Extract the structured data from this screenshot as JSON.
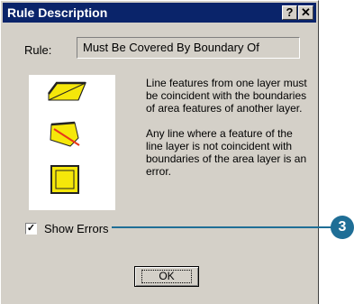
{
  "window": {
    "title": "Rule Description",
    "help_label": "?",
    "close_label": "✕"
  },
  "rule": {
    "label": "Rule:",
    "value": "Must Be Covered By Boundary Of"
  },
  "description": {
    "paragraph1": "Line features from one layer must be coincident with the boundaries of area features of another layer.",
    "paragraph2": "Any line where a feature of the line layer is not coincident with boundaries of the area layer is an error."
  },
  "icons": [
    "valid-coincident-line-icon",
    "error-line-icon",
    "covered-boundary-icon"
  ],
  "show_errors": {
    "label": "Show Errors",
    "checked": true,
    "mark": "✓"
  },
  "callout": {
    "number": "3"
  },
  "ok_label": "OK",
  "colors": {
    "title_bar": "#0a246a",
    "dialog_bg": "#d4d0c8",
    "feature_fill": "#f5e70a",
    "error_line": "#e8361b",
    "callout": "#1f6e96"
  }
}
